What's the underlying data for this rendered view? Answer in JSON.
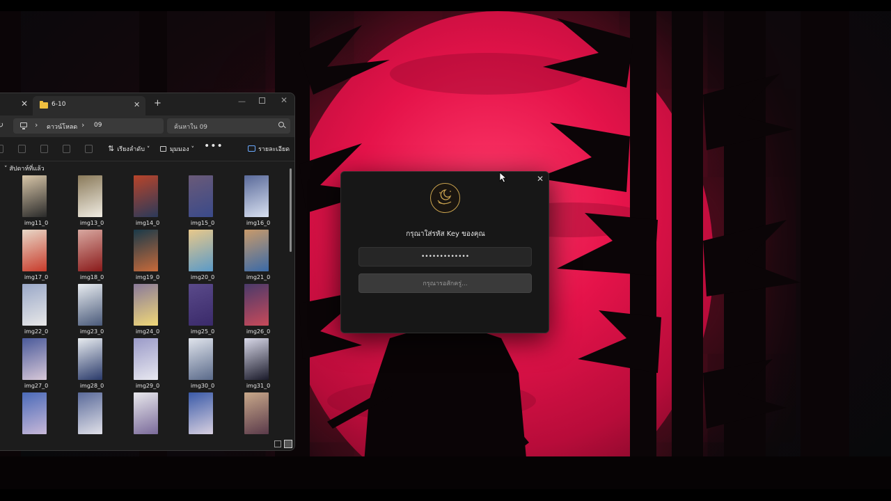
{
  "explorer": {
    "tab_label": "6-10",
    "tab_add": "+",
    "breadcrumb": [
      "ดาวน์โหลด",
      "09"
    ],
    "search_placeholder": "ค้นหาใน 09",
    "toolbar": {
      "sort_label": "เรียงลำดับ",
      "view_label": "มุมมอง",
      "more_label": "•••",
      "details_label": "รายละเอียด"
    },
    "group_header": "สัปดาห์ที่แล้ว",
    "items": [
      {
        "name": "img11_0",
        "c1": "#d8c6a8",
        "c2": "#2a2a2a"
      },
      {
        "name": "img13_0",
        "c1": "#8a7a5a",
        "c2": "#f0ece2"
      },
      {
        "name": "img14_0",
        "c1": "#b8442a",
        "c2": "#2b3a5a"
      },
      {
        "name": "img15_0",
        "c1": "#6a5a78",
        "c2": "#3a4a8a"
      },
      {
        "name": "img16_0",
        "c1": "#5a6a9a",
        "c2": "#d8e0f0"
      },
      {
        "name": "img17_0",
        "c1": "#e8d8c8",
        "c2": "#c83a2a"
      },
      {
        "name": "img18_0",
        "c1": "#d8a8a0",
        "c2": "#8a1a1a"
      },
      {
        "name": "img19_0",
        "c1": "#1a3a4a",
        "c2": "#c86a3a"
      },
      {
        "name": "img20_0",
        "c1": "#e8c88a",
        "c2": "#5a9ac8"
      },
      {
        "name": "img21_0",
        "c1": "#c89a6a",
        "c2": "#3a6aa8"
      },
      {
        "name": "img22_0",
        "c1": "#9aa8c8",
        "c2": "#e8e8e8"
      },
      {
        "name": "img23_0",
        "c1": "#e8ecf0",
        "c2": "#4a5a7a"
      },
      {
        "name": "img24_0",
        "c1": "#8a7a9a",
        "c2": "#f0d878"
      },
      {
        "name": "img25_0",
        "c1": "#5a4a8a",
        "c2": "#3a2a6a"
      },
      {
        "name": "img26_0",
        "c1": "#4a3a6a",
        "c2": "#c84a5a"
      },
      {
        "name": "img27_0",
        "c1": "#4a5a9a",
        "c2": "#d8c8d8"
      },
      {
        "name": "img28_0",
        "c1": "#e8ecf0",
        "c2": "#2a3a6a"
      },
      {
        "name": "img29_0",
        "c1": "#9a9ac8",
        "c2": "#e8e8f0"
      },
      {
        "name": "img30_0",
        "c1": "#e0e4ec",
        "c2": "#5a6a8a"
      },
      {
        "name": "img31_0",
        "c1": "#d8d8e8",
        "c2": "#1a1a2a"
      },
      {
        "name": "",
        "c1": "#4a6ab8",
        "c2": "#c8b8d8"
      },
      {
        "name": "",
        "c1": "#5a6a9a",
        "c2": "#e0e0e8"
      },
      {
        "name": "",
        "c1": "#e8e8ec",
        "c2": "#7a6a9a"
      },
      {
        "name": "",
        "c1": "#3a5aa8",
        "c2": "#d8d0e0"
      },
      {
        "name": "",
        "c1": "#c8a88a",
        "c2": "#5a3a4a"
      }
    ]
  },
  "dialog": {
    "title": "กรุณาใส่รหัส Key ของคุณ",
    "key_value": "•••••••••••••",
    "submit_label": "กรุณารอสักครู่...",
    "close_label": "✕"
  },
  "colors": {
    "moon": "#e5134a",
    "dialog_bg": "#171717",
    "explorer_bg": "#1c1c1c",
    "logo_gold": "#c9a24e"
  }
}
